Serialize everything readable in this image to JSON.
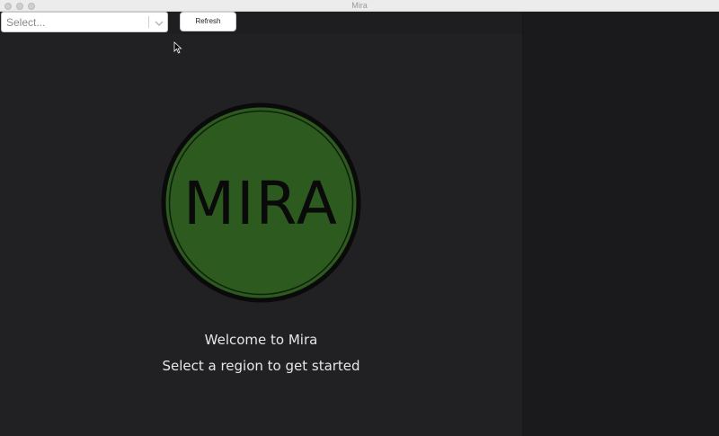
{
  "window": {
    "title": "Mira"
  },
  "toolbar": {
    "region_select": {
      "placeholder": "Select..."
    },
    "refresh_label": "Refresh"
  },
  "logo": {
    "text": "MIRA"
  },
  "welcome": {
    "title": "Welcome to Mira",
    "instruction": "Select a region to get started"
  },
  "colors": {
    "logo_fill": "#2d5a1f",
    "logo_ring": "#0a0a0a",
    "background": "#212123",
    "text": "#e6e6e6"
  },
  "icons": [
    "chevron-down-icon",
    "mouse-pointer-icon"
  ]
}
